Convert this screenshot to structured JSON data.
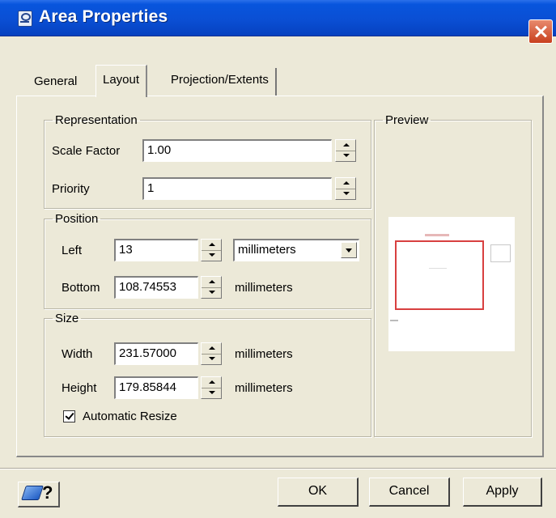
{
  "window": {
    "title": "Area Properties"
  },
  "tabs": [
    {
      "label": "General",
      "active": false
    },
    {
      "label": "Layout",
      "active": true
    },
    {
      "label": "Projection/Extents",
      "active": false
    }
  ],
  "representation": {
    "legend": "Representation",
    "scale_factor": {
      "label": "Scale Factor",
      "value": "1.00"
    },
    "priority": {
      "label": "Priority",
      "value": "1"
    }
  },
  "position": {
    "legend": "Position",
    "left": {
      "label": "Left",
      "value": "13",
      "unit_selected": "millimeters"
    },
    "bottom": {
      "label": "Bottom",
      "value": "108.74553",
      "unit": "millimeters"
    }
  },
  "size": {
    "legend": "Size",
    "width": {
      "label": "Width",
      "value": "231.57000",
      "unit": "millimeters"
    },
    "height": {
      "label": "Height",
      "value": "179.85844",
      "unit": "millimeters"
    },
    "automatic_resize": {
      "label": "Automatic Resize",
      "checked": true
    }
  },
  "preview": {
    "legend": "Preview"
  },
  "buttons": {
    "help": "?",
    "ok": "OK",
    "cancel": "Cancel",
    "apply": "Apply"
  },
  "colors": {
    "titlebar": "#0a4fd4",
    "preview_frame": "#d84040"
  }
}
